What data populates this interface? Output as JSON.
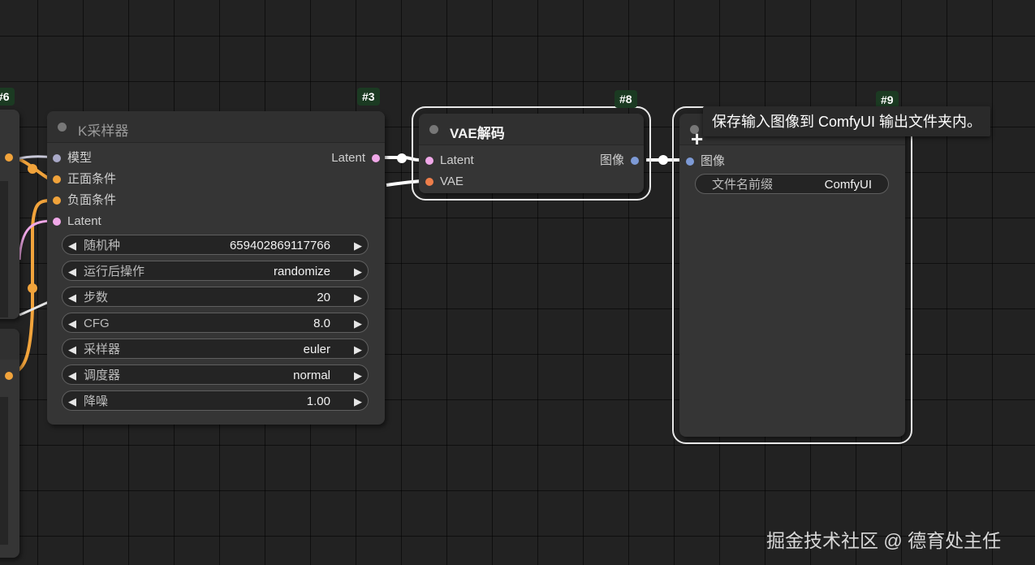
{
  "nodes": {
    "left_partial": {
      "badge": "#6"
    },
    "ksampler": {
      "id_badge": "#3",
      "title": "K采样器",
      "inputs": [
        {
          "label": "模型",
          "color": "#a9a9c8"
        },
        {
          "label": "正面条件",
          "color": "#f1a33b"
        },
        {
          "label": "负面条件",
          "color": "#f1a33b"
        },
        {
          "label": "Latent",
          "color": "#f0a8e8"
        }
      ],
      "output": {
        "label": "Latent",
        "color": "#f0a8e8"
      },
      "widgets": [
        {
          "label": "随机种",
          "value": "659402869117766"
        },
        {
          "label": "运行后操作",
          "value": "randomize"
        },
        {
          "label": "步数",
          "value": "20"
        },
        {
          "label": "CFG",
          "value": "8.0"
        },
        {
          "label": "采样器",
          "value": "euler"
        },
        {
          "label": "调度器",
          "value": "normal"
        },
        {
          "label": "降噪",
          "value": "1.00"
        }
      ]
    },
    "vae_decode": {
      "id_badge": "#8",
      "title": "VAE解码",
      "inputs": [
        {
          "label": "Latent",
          "color": "#f0a8e8"
        },
        {
          "label": "VAE",
          "color": "#ee7e4a"
        }
      ],
      "output": {
        "label": "图像",
        "color": "#7d9ad6"
      }
    },
    "save_image": {
      "id_badge": "#9",
      "input": {
        "label": "图像",
        "color": "#7d9ad6"
      },
      "widget": {
        "label": "文件名前缀",
        "value": "ComfyUI"
      }
    }
  },
  "tooltip": "保存输入图像到 ComfyUI 输出文件夹内。",
  "watermark": "掘金技术社区 @ 德育处主任",
  "colors": {
    "canvas": "#222222",
    "node": "#353535",
    "badge_bg": "#1b3a22",
    "wire_conditioning": "#f1a33b",
    "wire_latent": "#f0a8e8",
    "wire_model": "#a9a9c8",
    "wire_selected": "#ffffff"
  }
}
